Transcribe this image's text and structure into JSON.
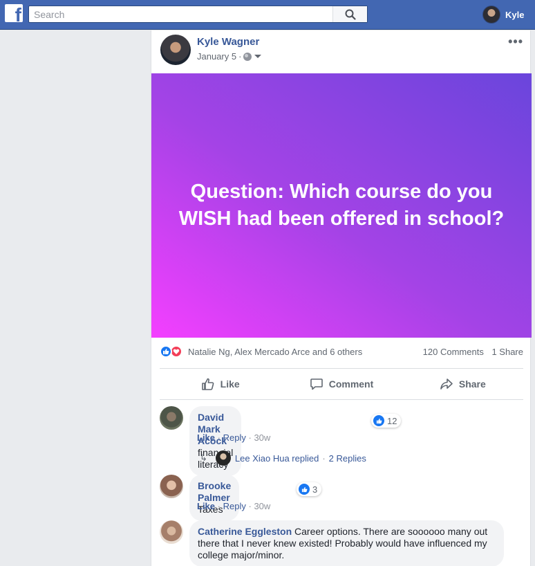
{
  "header": {
    "search_placeholder": "Search",
    "user_name": "Kyle"
  },
  "post": {
    "author": "Kyle Wagner",
    "date": "January 5",
    "date_sep": "·",
    "more": "•••",
    "text": "Question: Which course do you WISH had been offered in school?",
    "reactions_summary": "Natalie Ng, Alex Mercado Arce and 6 others",
    "comments_count": "120 Comments",
    "shares_count": "1 Share",
    "actions": {
      "like": "Like",
      "comment": "Comment",
      "share": "Share"
    }
  },
  "comments": [
    {
      "name": "David Mark Acock",
      "text": "financial literacy",
      "likes": "12",
      "like": "Like",
      "reply": "Reply",
      "time": "30w",
      "dot": "·"
    },
    {
      "name": "Brooke Palmer",
      "text": "Taxes",
      "likes": "3",
      "like": "Like",
      "reply": "Reply",
      "time": "30w",
      "dot": "·"
    },
    {
      "name": "Catherine Eggleston",
      "text": "Career options. There are soooooo many out there that I never knew existed! Probably would have influenced my college major/minor."
    }
  ],
  "replies_row": {
    "text": "Lee Xiao Hua replied",
    "sep": "·",
    "count": "2 Replies"
  },
  "colors": {
    "topbar": "#4267b2",
    "link": "#385898",
    "banner_start": "#f43fff",
    "banner_end": "#6a45dc"
  }
}
